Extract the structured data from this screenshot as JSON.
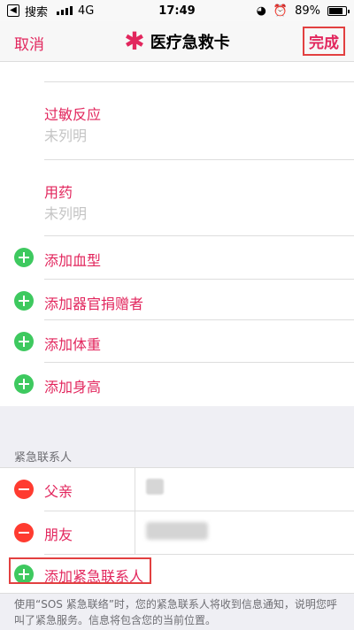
{
  "status_bar": {
    "back_app": "搜索",
    "network": "4G",
    "time": "17:49",
    "battery": "89%"
  },
  "nav": {
    "cancel": "取消",
    "title": "医疗急救卡",
    "done": "完成"
  },
  "fields": [
    {
      "label": "过敏反应",
      "value": "未列明"
    },
    {
      "label": "用药",
      "value": "未列明"
    }
  ],
  "add_items": [
    "添加血型",
    "添加器官捐赠者",
    "添加体重",
    "添加身高"
  ],
  "emergency": {
    "header": "紧急联系人",
    "contacts": [
      {
        "relation": "父亲"
      },
      {
        "relation": "朋友"
      }
    ],
    "add_label": "添加紧急联系人",
    "footnote": "使用“SOS 紧急联络”时，您的紧急联系人将收到信息通知，说明您呼叫了紧急服务。信息将包含您的当前位置。"
  },
  "colors": {
    "accent": "#e2265d",
    "add_green": "#3ec95f",
    "remove_red": "#ff3b30",
    "highlight": "#e24040"
  }
}
